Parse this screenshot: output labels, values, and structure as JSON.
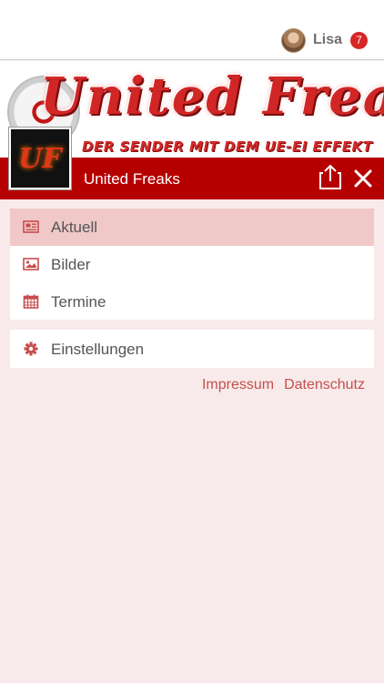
{
  "header": {
    "user_name": "Lisa",
    "notification_count": "7"
  },
  "banner": {
    "title": "United Freaks",
    "slogan": "DER SENDER MIT DEM UE-EI EFFEKT",
    "logo_text": "UF"
  },
  "channel": {
    "name": "United Freaks"
  },
  "menu": {
    "items": [
      {
        "label": "Aktuell",
        "icon": "newspaper-icon",
        "active": true
      },
      {
        "label": "Bilder",
        "icon": "image-icon",
        "active": false
      },
      {
        "label": "Termine",
        "icon": "calendar-icon",
        "active": false
      }
    ]
  },
  "settings": {
    "label": "Einstellungen",
    "icon": "gear-icon"
  },
  "footer": {
    "impressum": "Impressum",
    "datenschutz": "Datenschutz"
  },
  "colors": {
    "accent": "#b60000",
    "icon": "#c84c4c",
    "active_item": "#f0c8c8",
    "background": "#f8eaea"
  }
}
